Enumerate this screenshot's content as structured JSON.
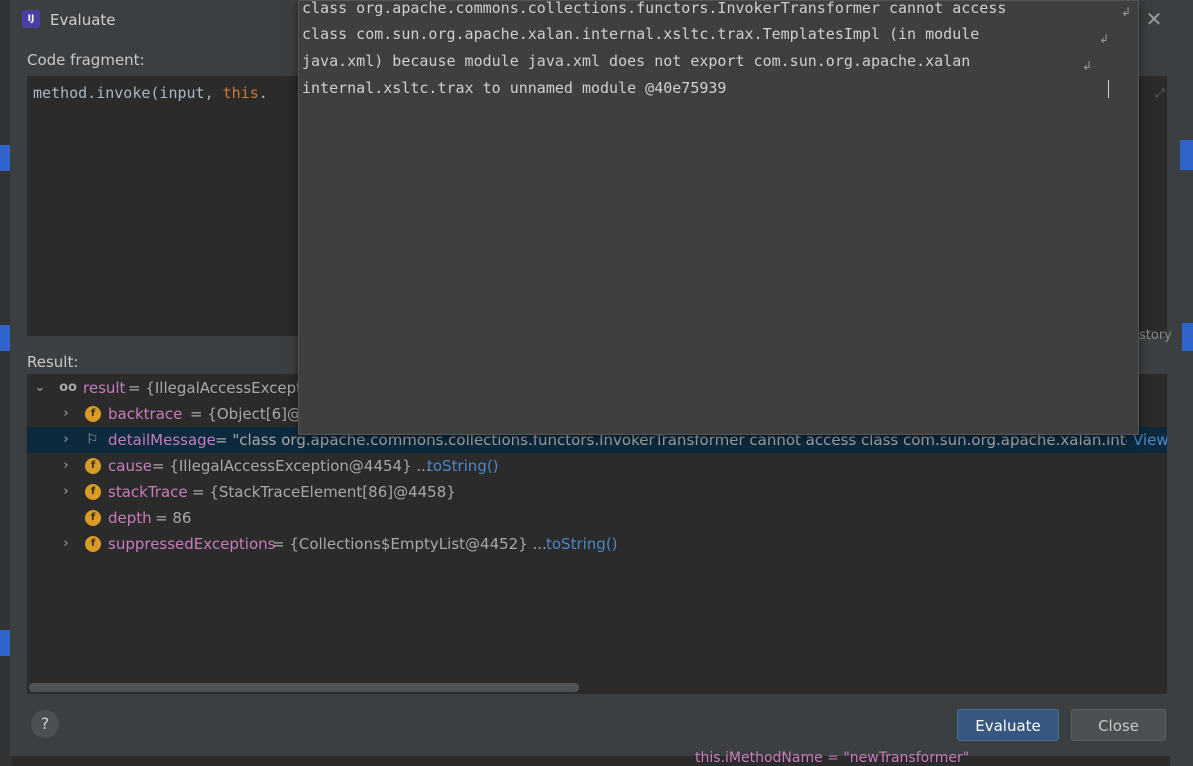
{
  "dialog": {
    "title": "Evaluate",
    "app_icon_text": "IJ",
    "close_icon": "close-icon",
    "code_label": "Code fragment:",
    "code": {
      "prefix": "method.invoke(input, ",
      "keyword": "this",
      "suffix": "."
    },
    "result_label": "Result:",
    "buttons": {
      "evaluate": "Evaluate",
      "close": "Close",
      "help": "?"
    }
  },
  "popup": {
    "lines": [
      "class org.apache.commons.collections.functors.InvokerTransformer cannot access",
      "class com.sun.org.apache.xalan.internal.xsltc.trax.TemplatesImpl (in module",
      "java.xml) because module java.xml does not export com.sun.org.apache.xalan",
      "internal.xsltc.trax to unnamed module @40e75939"
    ]
  },
  "tree": {
    "result": {
      "name": "result",
      "value": " = {IllegalAccessExcepti"
    },
    "rows": [
      {
        "name": "backtrace",
        "value": " = {Object[6]@4",
        "link": ""
      },
      {
        "name": "detailMessage",
        "value": " = \"class org.apache.commons.collections.functors.InvokerTransformer cannot access class com.sun.org.apache.xalan.inter... ",
        "link": "View"
      },
      {
        "name": "cause",
        "value": " = {IllegalAccessException@4454}  ... ",
        "link": "toString()"
      },
      {
        "name": "stackTrace",
        "value": " = {StackTraceElement[86]@4458}",
        "link": ""
      },
      {
        "name": "depth",
        "value": " = 86",
        "link": ""
      },
      {
        "name": "suppressedExceptions",
        "value": " = {Collections$EmptyList@4452}  ... ",
        "link": "toString()"
      }
    ]
  },
  "background": {
    "history_text": "story",
    "bottom_right": "this.iMethodName = \"newTransformer\""
  },
  "colors": {
    "accent": "#365880",
    "selection": "#0d293e",
    "field_badge": "#d89b28",
    "var_name": "#c77dbb",
    "link": "#4a88c7"
  }
}
